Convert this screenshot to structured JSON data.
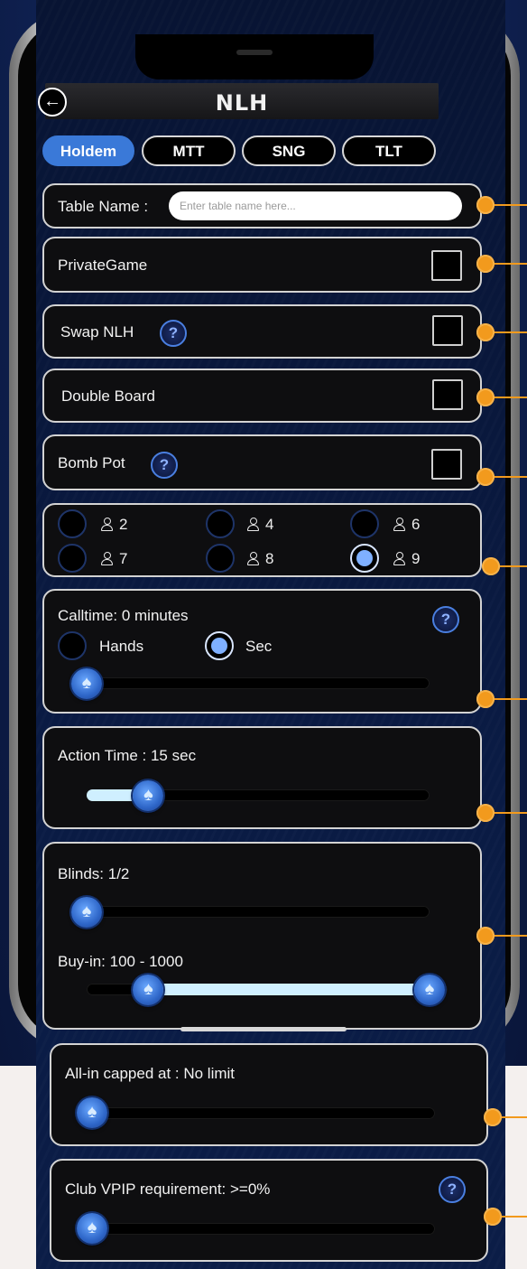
{
  "header": {
    "title": "NLH",
    "back_icon": "arrow-left-icon",
    "back_glyph": "←"
  },
  "tabs": [
    {
      "label": "Holdem",
      "active": true
    },
    {
      "label": "MTT",
      "active": false
    },
    {
      "label": "SNG",
      "active": false
    },
    {
      "label": "TLT",
      "active": false
    }
  ],
  "table_name": {
    "label": "Table Name :",
    "placeholder": "Enter table name here...",
    "value": ""
  },
  "private_game": {
    "label": "PrivateGame",
    "checked": false
  },
  "swap_nlh": {
    "label": "Swap NLH",
    "checked": false,
    "help": "?"
  },
  "double_board": {
    "label": "Double Board",
    "checked": false
  },
  "bomb_pot": {
    "label": "Bomb Pot",
    "checked": false,
    "help": "?"
  },
  "seats": {
    "options": [
      "2",
      "4",
      "6",
      "7",
      "8",
      "9"
    ],
    "selected": "9"
  },
  "calltime": {
    "label": "Calltime: 0 minutes",
    "help": "?",
    "mode_options": [
      "Hands",
      "Sec"
    ],
    "mode_selected": "Sec",
    "slider_fraction": 0
  },
  "action_time": {
    "label": "Action Time : 15 sec",
    "slider_fraction": 0.18
  },
  "blinds": {
    "label": "Blinds: 1/2",
    "slider_fraction": 0
  },
  "buy_in": {
    "label": "Buy-in: 100 - 1000",
    "range_low_fraction": 0.18,
    "range_high_fraction": 1.0
  },
  "all_in_cap": {
    "label": "All-in capped at : No limit",
    "slider_fraction": 0
  },
  "club_vpip": {
    "label": "Club VPIP requirement: >=0%",
    "help": "?",
    "slider_fraction": 0
  },
  "colors": {
    "accent": "#3a79d8",
    "marker": "#f29a1d",
    "slider_fill": "#cfefff",
    "card_border": "#d3d3d3"
  }
}
